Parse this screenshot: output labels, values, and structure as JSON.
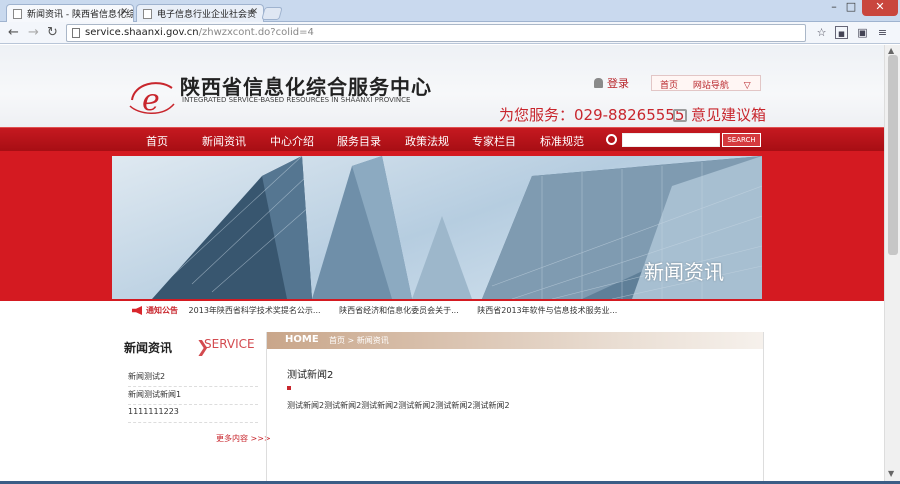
{
  "browser": {
    "tabs": [
      {
        "title": "新闻资讯 - 陕西省信息化综",
        "active": true
      },
      {
        "title": "电子信息行业企业社会责",
        "active": false
      }
    ],
    "url_host": "service.shaanxi.gov.cn",
    "url_path": "/zhwzxcont.do?colid=4"
  },
  "header": {
    "site_title": "陕西省信息化综合服务中心",
    "site_subtitle": "INTEGRATED SERVICE-BASED RESOURCES IN SHAANXI PROVINCE",
    "login_label": "登录",
    "top_links": [
      "首页",
      "网站导航"
    ],
    "service_phone": "为您服务：029-88265555",
    "feedback_label": "意见建议箱"
  },
  "nav": {
    "items": [
      "首页",
      "新闻资讯",
      "中心介绍",
      "服务目录",
      "政策法规",
      "专家栏目",
      "标准规范"
    ],
    "active_index": 1,
    "search_button": "SEARCH",
    "accent_color": "#c61920"
  },
  "banner": {
    "title": "新闻资讯"
  },
  "notice": {
    "label": "通知公告",
    "items": [
      "2013年陕西省科学技术奖提名公示...",
      "陕西省经济和信息化委员会关于...",
      "陕西省2013年软件与信息技术服务业..."
    ]
  },
  "sidebar": {
    "title": "新闻资讯",
    "service_label": "SERVICE",
    "items": [
      "新闻测试2",
      "新闻测试新闻1",
      "1111111223"
    ],
    "more_label": "更多内容 >>>"
  },
  "content": {
    "crumb_home": "HOME",
    "crumb_path": "首页 > 新闻资讯",
    "article_title": "测试新闻2",
    "article_body": "测试新闻2测试新闻2测试新闻2测试新闻2测试新闻2测试新闻2"
  }
}
